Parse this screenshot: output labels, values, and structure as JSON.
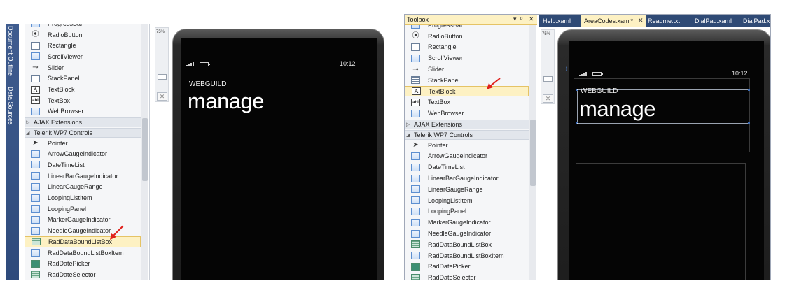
{
  "left": {
    "side_tabs": [
      "Document Outline",
      "Data Sources"
    ],
    "toolbox_items_top": [
      {
        "label": "ProgressBar",
        "icon": "progressbar-icon"
      },
      {
        "label": "RadioButton",
        "icon": "radiobutton-icon"
      },
      {
        "label": "Rectangle",
        "icon": "rectangle-icon"
      },
      {
        "label": "ScrollViewer",
        "icon": "scrollviewer-icon"
      },
      {
        "label": "Slider",
        "icon": "slider-icon"
      },
      {
        "label": "StackPanel",
        "icon": "stackpanel-icon"
      },
      {
        "label": "TextBlock",
        "icon": "textblock-icon"
      },
      {
        "label": "TextBox",
        "icon": "textbox-icon"
      },
      {
        "label": "WebBrowser",
        "icon": "webbrowser-icon"
      }
    ],
    "category_ajax": "AJAX Extensions",
    "category_telerik": "Telerik WP7 Controls",
    "toolbox_items_telerik": [
      {
        "label": "Pointer",
        "icon": "pointer-icon"
      },
      {
        "label": "ArrowGaugeIndicator",
        "icon": "control-icon"
      },
      {
        "label": "DateTimeList",
        "icon": "control-icon"
      },
      {
        "label": "LinearBarGaugeIndicator",
        "icon": "control-icon"
      },
      {
        "label": "LinearGaugeRange",
        "icon": "control-icon"
      },
      {
        "label": "LoopingListItem",
        "icon": "control-icon"
      },
      {
        "label": "LoopingPanel",
        "icon": "control-icon"
      },
      {
        "label": "MarkerGaugeIndicator",
        "icon": "control-icon"
      },
      {
        "label": "NeedleGaugeIndicator",
        "icon": "control-icon"
      },
      {
        "label": "RadDataBoundListBox",
        "icon": "listbox-icon"
      },
      {
        "label": "RadDataBoundListBoxItem",
        "icon": "control-icon"
      },
      {
        "label": "RadDatePicker",
        "icon": "datepicker-icon"
      },
      {
        "label": "RadDateSelector",
        "icon": "dateselector-icon"
      }
    ],
    "selected_item": "RadDataBoundListBox",
    "zoom": "75%",
    "phone": {
      "time": "10:12",
      "app_title": "WEBGUILD",
      "page_title": "manage"
    }
  },
  "right": {
    "toolbox_title": "Toolbox",
    "header_buttons": [
      "▾",
      "ᵖ",
      "✕"
    ],
    "doc_tabs": [
      {
        "label": "Help.xaml",
        "active": false
      },
      {
        "label": "AreaCodes.xaml*",
        "active": true
      },
      {
        "label": "Readme.txt",
        "active": false
      },
      {
        "label": "DialPad.xaml",
        "active": false
      },
      {
        "label": "DialPad.xa",
        "active": false
      }
    ],
    "toolbox_items_top": [
      {
        "label": "ProgressBar",
        "icon": "progressbar-icon"
      },
      {
        "label": "RadioButton",
        "icon": "radiobutton-icon"
      },
      {
        "label": "Rectangle",
        "icon": "rectangle-icon"
      },
      {
        "label": "ScrollViewer",
        "icon": "scrollviewer-icon"
      },
      {
        "label": "Slider",
        "icon": "slider-icon"
      },
      {
        "label": "StackPanel",
        "icon": "stackpanel-icon"
      },
      {
        "label": "TextBlock",
        "icon": "textblock-icon"
      },
      {
        "label": "TextBox",
        "icon": "textbox-icon"
      },
      {
        "label": "WebBrowser",
        "icon": "webbrowser-icon"
      }
    ],
    "category_ajax": "AJAX Extensions",
    "category_telerik": "Telerik WP7 Controls",
    "toolbox_items_telerik": [
      {
        "label": "Pointer",
        "icon": "pointer-icon"
      },
      {
        "label": "ArrowGaugeIndicator",
        "icon": "control-icon"
      },
      {
        "label": "DateTimeList",
        "icon": "control-icon"
      },
      {
        "label": "LinearBarGaugeIndicator",
        "icon": "control-icon"
      },
      {
        "label": "LinearGaugeRange",
        "icon": "control-icon"
      },
      {
        "label": "LoopingListItem",
        "icon": "control-icon"
      },
      {
        "label": "LoopingPanel",
        "icon": "control-icon"
      },
      {
        "label": "MarkerGaugeIndicator",
        "icon": "control-icon"
      },
      {
        "label": "NeedleGaugeIndicator",
        "icon": "control-icon"
      },
      {
        "label": "RadDataBoundListBox",
        "icon": "listbox-icon"
      },
      {
        "label": "RadDataBoundListBoxItem",
        "icon": "control-icon"
      },
      {
        "label": "RadDatePicker",
        "icon": "datepicker-icon"
      },
      {
        "label": "RadDateSelector",
        "icon": "dateselector-icon"
      }
    ],
    "selected_item": "TextBlock",
    "zoom": "75%",
    "phone": {
      "time": "10:12",
      "app_title": "WEBGUILD",
      "page_title": "manage"
    }
  },
  "colors": {
    "selection": "#fdf1c3",
    "side_strip": "#3f5c8f",
    "doc_tab_strip": "#2f4a75",
    "arrow": "#e0201b"
  }
}
